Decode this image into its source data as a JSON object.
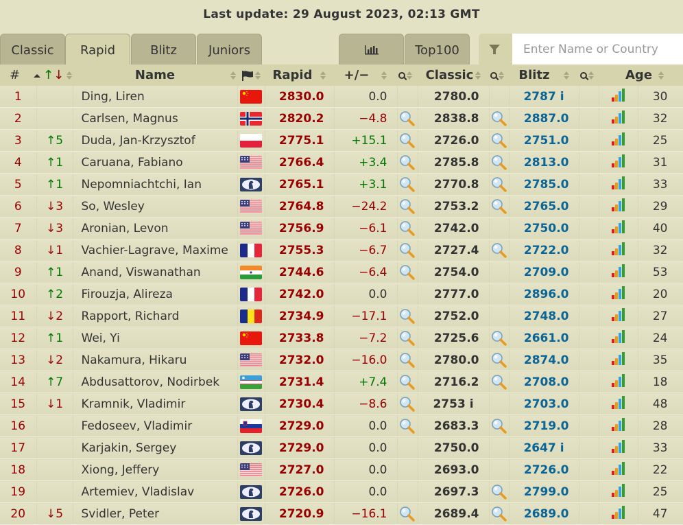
{
  "header": {
    "last_update": "Last update: 29 August 2023, 02:13 GMT"
  },
  "tabs": [
    {
      "label": "Classic",
      "active": false
    },
    {
      "label": "Rapid",
      "active": true
    },
    {
      "label": "Blitz",
      "active": false
    },
    {
      "label": "Juniors",
      "active": false
    }
  ],
  "toolbar": {
    "chart_icon": "bar-chart-icon",
    "top100_label": "Top100",
    "filter_icon": "filter-funnel-icon"
  },
  "search": {
    "placeholder": "Enter Name or Country",
    "value": ""
  },
  "columns": {
    "rank": "#",
    "change": "↑↓",
    "name": "Name",
    "flag_icon": "flag-icon",
    "rapid": "Rapid",
    "diff": "+/−",
    "classic": "Classic",
    "blitz": "Blitz",
    "age": "Age"
  },
  "colors": {
    "rank_red": "#990000",
    "up_green": "#007700",
    "blitz_blue": "#0a6496",
    "header_bg": "#d6d4ad",
    "row_bg": "#e3e2c5"
  },
  "rows": [
    {
      "rank": "1",
      "change": "",
      "dir": "",
      "name": "Ding, Liren",
      "country": "CHN",
      "rapid": "2830.0",
      "diff": "0.0",
      "classic_mag": false,
      "classic": "2780.0",
      "blitz_mag": false,
      "blitz": "2787 i",
      "age": "30"
    },
    {
      "rank": "2",
      "change": "",
      "dir": "",
      "name": "Carlsen, Magnus",
      "country": "NOR",
      "rapid": "2820.2",
      "diff": "−4.8",
      "classic_mag": true,
      "classic": "2838.8",
      "blitz_mag": true,
      "blitz": "2887.0",
      "age": "32"
    },
    {
      "rank": "3",
      "change": "↑5",
      "dir": "up",
      "name": "Duda, Jan-Krzysztof",
      "country": "POL",
      "rapid": "2775.1",
      "diff": "+15.1",
      "classic_mag": true,
      "classic": "2726.0",
      "blitz_mag": true,
      "blitz": "2751.0",
      "age": "25"
    },
    {
      "rank": "4",
      "change": "↑1",
      "dir": "up",
      "name": "Caruana, Fabiano",
      "country": "USA",
      "rapid": "2766.4",
      "diff": "+3.4",
      "classic_mag": true,
      "classic": "2785.8",
      "blitz_mag": true,
      "blitz": "2813.0",
      "age": "31"
    },
    {
      "rank": "5",
      "change": "↑1",
      "dir": "up",
      "name": "Nepomniachtchi, Ian",
      "country": "FID",
      "rapid": "2765.1",
      "diff": "+3.1",
      "classic_mag": true,
      "classic": "2770.8",
      "blitz_mag": true,
      "blitz": "2785.0",
      "age": "33"
    },
    {
      "rank": "6",
      "change": "↓3",
      "dir": "down",
      "name": "So, Wesley",
      "country": "USA",
      "rapid": "2764.8",
      "diff": "−24.2",
      "classic_mag": true,
      "classic": "2753.2",
      "blitz_mag": true,
      "blitz": "2765.0",
      "age": "29"
    },
    {
      "rank": "7",
      "change": "↓3",
      "dir": "down",
      "name": "Aronian, Levon",
      "country": "USA",
      "rapid": "2756.9",
      "diff": "−6.1",
      "classic_mag": true,
      "classic": "2742.0",
      "blitz_mag": false,
      "blitz": "2750.0",
      "age": "40"
    },
    {
      "rank": "8",
      "change": "↓1",
      "dir": "down",
      "name": "Vachier-Lagrave, Maxime",
      "country": "FRA",
      "rapid": "2755.3",
      "diff": "−6.7",
      "classic_mag": true,
      "classic": "2727.4",
      "blitz_mag": true,
      "blitz": "2722.0",
      "age": "32"
    },
    {
      "rank": "9",
      "change": "↑1",
      "dir": "up",
      "name": "Anand, Viswanathan",
      "country": "IND",
      "rapid": "2744.6",
      "diff": "−6.4",
      "classic_mag": true,
      "classic": "2754.0",
      "blitz_mag": false,
      "blitz": "2709.0",
      "age": "53"
    },
    {
      "rank": "10",
      "change": "↑2",
      "dir": "up",
      "name": "Firouzja, Alireza",
      "country": "FRA",
      "rapid": "2742.0",
      "diff": "0.0",
      "classic_mag": false,
      "classic": "2777.0",
      "blitz_mag": false,
      "blitz": "2896.0",
      "age": "20"
    },
    {
      "rank": "11",
      "change": "↓2",
      "dir": "down",
      "name": "Rapport, Richard",
      "country": "ROU",
      "rapid": "2734.9",
      "diff": "−17.1",
      "classic_mag": true,
      "classic": "2752.0",
      "blitz_mag": false,
      "blitz": "2748.0",
      "age": "27"
    },
    {
      "rank": "12",
      "change": "↑1",
      "dir": "up",
      "name": "Wei, Yi",
      "country": "CHN",
      "rapid": "2733.8",
      "diff": "−7.2",
      "classic_mag": true,
      "classic": "2725.6",
      "blitz_mag": true,
      "blitz": "2661.0",
      "age": "24"
    },
    {
      "rank": "13",
      "change": "↓2",
      "dir": "down",
      "name": "Nakamura, Hikaru",
      "country": "USA",
      "rapid": "2732.0",
      "diff": "−16.0",
      "classic_mag": true,
      "classic": "2780.0",
      "blitz_mag": true,
      "blitz": "2874.0",
      "age": "35"
    },
    {
      "rank": "14",
      "change": "↑7",
      "dir": "up",
      "name": "Abdusattorov, Nodirbek",
      "country": "UZB",
      "rapid": "2731.4",
      "diff": "+7.4",
      "classic_mag": true,
      "classic": "2716.2",
      "blitz_mag": true,
      "blitz": "2708.0",
      "age": "18"
    },
    {
      "rank": "15",
      "change": "↓1",
      "dir": "down",
      "name": "Kramnik, Vladimir",
      "country": "FID",
      "rapid": "2730.4",
      "diff": "−8.6",
      "classic_mag": true,
      "classic": "2753 i",
      "blitz_mag": false,
      "blitz": "2703.0",
      "age": "48"
    },
    {
      "rank": "16",
      "change": "",
      "dir": "",
      "name": "Fedoseev, Vladimir",
      "country": "SLO",
      "rapid": "2729.0",
      "diff": "0.0",
      "classic_mag": true,
      "classic": "2683.3",
      "blitz_mag": true,
      "blitz": "2719.0",
      "age": "28"
    },
    {
      "rank": "17",
      "change": "",
      "dir": "",
      "name": "Karjakin, Sergey",
      "country": "FID",
      "rapid": "2729.0",
      "diff": "0.0",
      "classic_mag": false,
      "classic": "2750.0",
      "blitz_mag": false,
      "blitz": "2647 i",
      "age": "33"
    },
    {
      "rank": "18",
      "change": "",
      "dir": "",
      "name": "Xiong, Jeffery",
      "country": "USA",
      "rapid": "2727.0",
      "diff": "0.0",
      "classic_mag": false,
      "classic": "2693.0",
      "blitz_mag": false,
      "blitz": "2726.0",
      "age": "22"
    },
    {
      "rank": "19",
      "change": "",
      "dir": "",
      "name": "Artemiev, Vladislav",
      "country": "FID",
      "rapid": "2726.0",
      "diff": "0.0",
      "classic_mag": false,
      "classic": "2697.3",
      "blitz_mag": true,
      "blitz": "2799.0",
      "age": "25"
    },
    {
      "rank": "20",
      "change": "↓5",
      "dir": "down",
      "name": "Svidler, Peter",
      "country": "FID",
      "rapid": "2720.9",
      "diff": "−16.1",
      "classic_mag": true,
      "classic": "2689.4",
      "blitz_mag": true,
      "blitz": "2689.0",
      "age": "47"
    }
  ]
}
